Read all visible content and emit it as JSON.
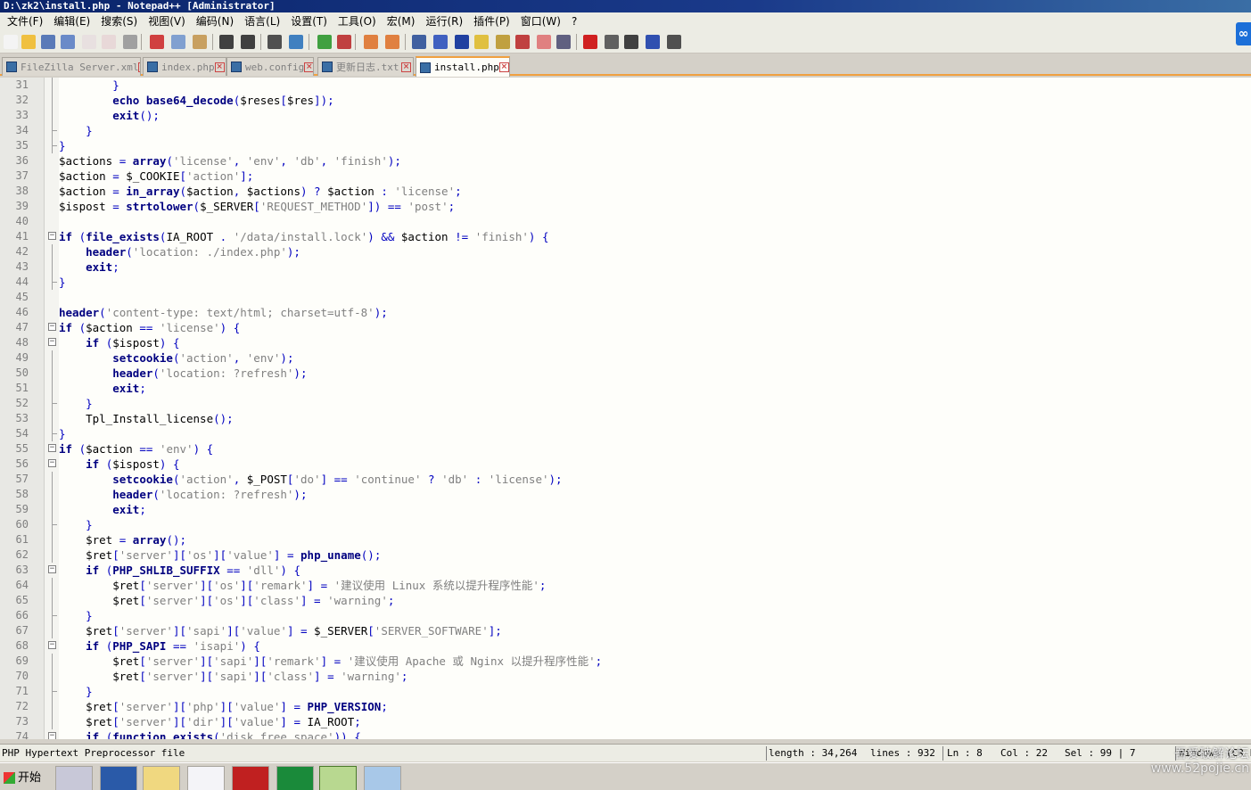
{
  "window": {
    "title": "D:\\zk2\\install.php - Notepad++ [Administrator]"
  },
  "menu": [
    "文件(F)",
    "编辑(E)",
    "搜索(S)",
    "视图(V)",
    "编码(N)",
    "语言(L)",
    "设置(T)",
    "工具(O)",
    "宏(M)",
    "运行(R)",
    "插件(P)",
    "窗口(W)",
    "?"
  ],
  "tabs": [
    {
      "label": "FileZilla Server.xml",
      "active": false
    },
    {
      "label": "index.php",
      "active": false
    },
    {
      "label": "web.config",
      "active": false
    },
    {
      "label": "更新日志.txt",
      "active": false
    },
    {
      "label": "install.php",
      "active": true
    }
  ],
  "lines": [
    {
      "n": "31",
      "fold": "line",
      "code": "        }"
    },
    {
      "n": "32",
      "fold": "line",
      "code": "        echo base64_decode($reses[$res]);"
    },
    {
      "n": "33",
      "fold": "line",
      "code": "        exit();"
    },
    {
      "n": "34",
      "fold": "end",
      "code": "    }"
    },
    {
      "n": "35",
      "fold": "end",
      "code": "}"
    },
    {
      "n": "36",
      "fold": "",
      "code": "$actions = array('license', 'env', 'db', 'finish');"
    },
    {
      "n": "37",
      "fold": "",
      "code": "$action = $_COOKIE['action'];"
    },
    {
      "n": "38",
      "fold": "",
      "code": "$action = in_array($action, $actions) ? $action : 'license';"
    },
    {
      "n": "39",
      "fold": "",
      "code": "$ispost = strtolower($_SERVER['REQUEST_METHOD']) == 'post';"
    },
    {
      "n": "40",
      "fold": "",
      "code": ""
    },
    {
      "n": "41",
      "fold": "open",
      "code": "if (file_exists(IA_ROOT . '/data/install.lock') && $action != 'finish') {"
    },
    {
      "n": "42",
      "fold": "line",
      "code": "    header('location: ./index.php');"
    },
    {
      "n": "43",
      "fold": "line",
      "code": "    exit;"
    },
    {
      "n": "44",
      "fold": "end",
      "code": "}"
    },
    {
      "n": "45",
      "fold": "",
      "code": ""
    },
    {
      "n": "46",
      "fold": "",
      "code": "header('content-type: text/html; charset=utf-8');"
    },
    {
      "n": "47",
      "fold": "open",
      "code": "if ($action == 'license') {"
    },
    {
      "n": "48",
      "fold": "open",
      "code": "    if ($ispost) {"
    },
    {
      "n": "49",
      "fold": "line",
      "code": "        setcookie('action', 'env');"
    },
    {
      "n": "50",
      "fold": "line",
      "code": "        header('location: ?refresh');"
    },
    {
      "n": "51",
      "fold": "line",
      "code": "        exit;"
    },
    {
      "n": "52",
      "fold": "end",
      "code": "    }"
    },
    {
      "n": "53",
      "fold": "line",
      "code": "    Tpl_Install_license();"
    },
    {
      "n": "54",
      "fold": "end",
      "code": "}"
    },
    {
      "n": "55",
      "fold": "open",
      "code": "if ($action == 'env') {"
    },
    {
      "n": "56",
      "fold": "open",
      "code": "    if ($ispost) {"
    },
    {
      "n": "57",
      "fold": "line",
      "code": "        setcookie('action', $_POST['do'] == 'continue' ? 'db' : 'license');"
    },
    {
      "n": "58",
      "fold": "line",
      "code": "        header('location: ?refresh');"
    },
    {
      "n": "59",
      "fold": "line",
      "code": "        exit;"
    },
    {
      "n": "60",
      "fold": "end",
      "code": "    }"
    },
    {
      "n": "61",
      "fold": "line",
      "code": "    $ret = array();"
    },
    {
      "n": "62",
      "fold": "line",
      "code": "    $ret['server']['os']['value'] = php_uname();"
    },
    {
      "n": "63",
      "fold": "open",
      "code": "    if (PHP_SHLIB_SUFFIX == 'dll') {"
    },
    {
      "n": "64",
      "fold": "line",
      "code": "        $ret['server']['os']['remark'] = '建议使用 Linux 系统以提升程序性能';"
    },
    {
      "n": "65",
      "fold": "line",
      "code": "        $ret['server']['os']['class'] = 'warning';"
    },
    {
      "n": "66",
      "fold": "end",
      "code": "    }"
    },
    {
      "n": "67",
      "fold": "line",
      "code": "    $ret['server']['sapi']['value'] = $_SERVER['SERVER_SOFTWARE'];"
    },
    {
      "n": "68",
      "fold": "open",
      "code": "    if (PHP_SAPI == 'isapi') {"
    },
    {
      "n": "69",
      "fold": "line",
      "code": "        $ret['server']['sapi']['remark'] = '建议使用 Apache 或 Nginx 以提升程序性能';"
    },
    {
      "n": "70",
      "fold": "line",
      "code": "        $ret['server']['sapi']['class'] = 'warning';"
    },
    {
      "n": "71",
      "fold": "end",
      "code": "    }"
    },
    {
      "n": "72",
      "fold": "line",
      "code": "    $ret['server']['php']['value'] = PHP_VERSION;"
    },
    {
      "n": "73",
      "fold": "line",
      "code": "    $ret['server']['dir']['value'] = IA_ROOT;"
    },
    {
      "n": "74",
      "fold": "open",
      "code": "    if (function_exists('disk_free_space')) {"
    }
  ],
  "status": {
    "filetype": "PHP Hypertext Preprocessor file",
    "length": "length : 34,264",
    "lines": "lines : 932",
    "ln": "Ln : 8",
    "col": "Col : 22",
    "sel": "Sel : 99 | 7",
    "eol": "Windows (CR LF)"
  },
  "taskbar": {
    "start": "开始"
  },
  "watermark": {
    "line1": "吾爱破解论坛",
    "line2": "www.52pojie.cn"
  },
  "colors": {
    "keyword": "#000080",
    "string": "#808080",
    "operator": "#0000c0",
    "highlight": "#ffff80"
  }
}
